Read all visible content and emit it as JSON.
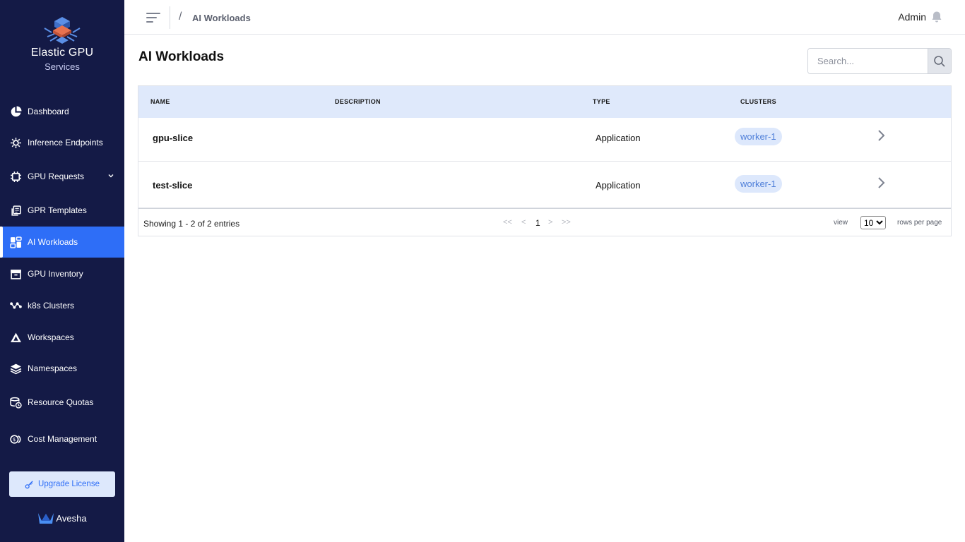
{
  "brand": {
    "title": "Elastic GPU",
    "subtitle": "Services"
  },
  "sidebar": {
    "items": [
      {
        "label": "Dashboard",
        "icon": "pie-chart-icon"
      },
      {
        "label": "Inference Endpoints",
        "icon": "gear-network-icon"
      },
      {
        "label": "GPU Requests",
        "icon": "chip-icon",
        "expandable": true
      },
      {
        "label": "GPR Templates",
        "icon": "copy-icon"
      },
      {
        "label": "AI Workloads",
        "icon": "dashboard-grid-icon",
        "active": true
      },
      {
        "label": "GPU Inventory",
        "icon": "archive-box-icon"
      },
      {
        "label": "k8s Clusters",
        "icon": "nodes-icon"
      },
      {
        "label": "Workspaces",
        "icon": "triangle-icon"
      },
      {
        "label": "Namespaces",
        "icon": "layers-icon"
      },
      {
        "label": "Resource Quotas",
        "icon": "database-clock-icon"
      },
      {
        "label": "Cost Management",
        "icon": "coins-icon"
      }
    ],
    "upgrade_label": "Upgrade License",
    "footer_brand": "Avesha"
  },
  "topbar": {
    "breadcrumb_separator": "/",
    "breadcrumb": "AI Workloads",
    "user": "Admin"
  },
  "main": {
    "title": "AI Workloads",
    "search_placeholder": "Search..."
  },
  "table": {
    "columns": [
      "NAME",
      "DESCRIPTION",
      "TYPE",
      "CLUSTERS"
    ],
    "rows": [
      {
        "name": "gpu-slice",
        "description": "",
        "type": "Application",
        "cluster": "worker-1"
      },
      {
        "name": "test-slice",
        "description": "",
        "type": "Application",
        "cluster": "worker-1"
      }
    ],
    "showing": "Showing 1 - 2 of 2 entries",
    "pagination": {
      "first": "<<",
      "prev": "<",
      "current": "1",
      "next": ">",
      "last": ">>"
    },
    "view_label": "view",
    "rows_per_page_value": "10",
    "rows_per_page_label": "rows per page"
  },
  "colors": {
    "sidebar_bg": "#141a46",
    "active": "#2e6ef7",
    "header_row": "#dfe9fb",
    "badge_bg": "#dde8fc",
    "badge_text": "#4f7fd9"
  }
}
